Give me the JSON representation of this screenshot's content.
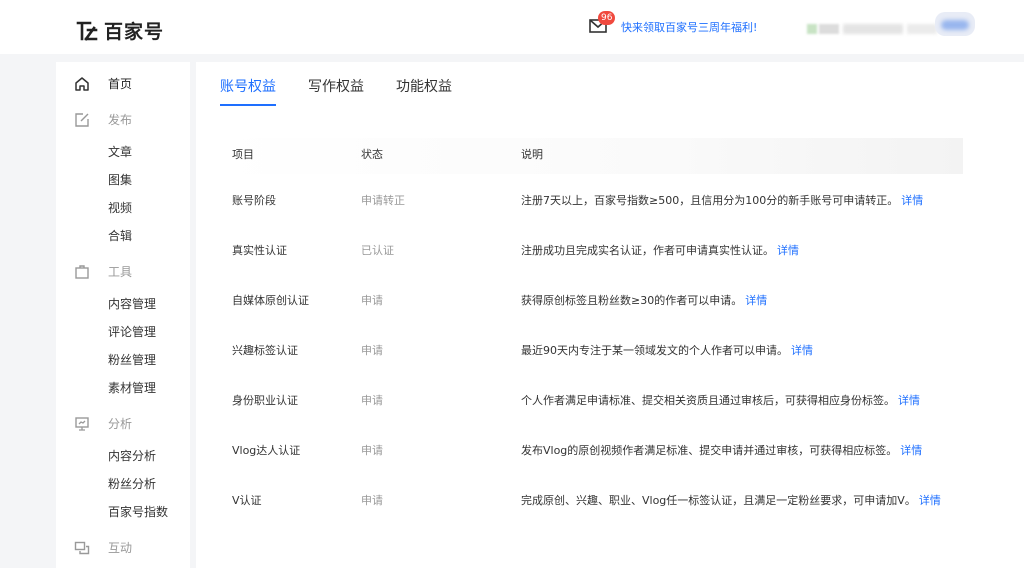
{
  "header": {
    "logo_text": "百家号",
    "mail_badge": "96",
    "promo_link": "快来领取百家号三周年福利!"
  },
  "sidebar": {
    "home": "首页",
    "publish": {
      "label": "发布",
      "items": [
        "文章",
        "图集",
        "视频",
        "合辑"
      ]
    },
    "tools": {
      "label": "工具",
      "items": [
        "内容管理",
        "评论管理",
        "粉丝管理",
        "素材管理"
      ]
    },
    "analysis": {
      "label": "分析",
      "items": [
        "内容分析",
        "粉丝分析",
        "百家号指数"
      ]
    },
    "interact": {
      "label": "互动"
    }
  },
  "tabs": [
    "账号权益",
    "写作权益",
    "功能权益"
  ],
  "table": {
    "headers": [
      "项目",
      "状态",
      "说明"
    ],
    "detail_label": "详情",
    "rows": [
      {
        "name": "账号阶段",
        "status": "申请转正",
        "desc": "注册7天以上，百家号指数≥500，且信用分为100分的新手账号可申请转正。"
      },
      {
        "name": "真实性认证",
        "status": "已认证",
        "desc": "注册成功且完成实名认证，作者可申请真实性认证。"
      },
      {
        "name": "自媒体原创认证",
        "status": "申请",
        "desc": "获得原创标签且粉丝数≥30的作者可以申请。"
      },
      {
        "name": "兴趣标签认证",
        "status": "申请",
        "desc": "最近90天内专注于某一领域发文的个人作者可以申请。"
      },
      {
        "name": "身份职业认证",
        "status": "申请",
        "desc": "个人作者满足申请标准、提交相关资质且通过审核后，可获得相应身份标签。"
      },
      {
        "name": "Vlog达人认证",
        "status": "申请",
        "desc": "发布Vlog的原创视频作者满足标准、提交申请并通过审核，可获得相应标签。"
      },
      {
        "name": "V认证",
        "status": "申请",
        "desc": "完成原创、兴趣、职业、Vlog任一标签认证，且满足一定粉丝要求，可申请加V。"
      }
    ]
  },
  "colors": {
    "accent": "#1e6fff",
    "badge": "#f0493e",
    "muted": "#999999"
  }
}
